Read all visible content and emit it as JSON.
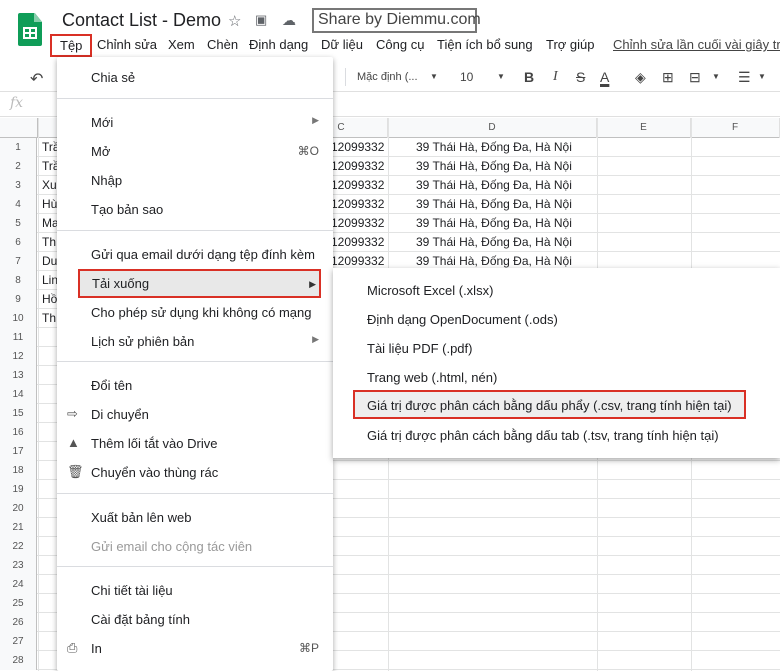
{
  "title_bar": {
    "doc_title": "Contact List - Demo",
    "watermark": "Share by Diemmu.com"
  },
  "menu_bar": {
    "items": [
      "Tệp",
      "Chỉnh sửa",
      "Xem",
      "Chèn",
      "Định dạng",
      "Dữ liệu",
      "Công cụ",
      "Tiện ích bổ sung",
      "Trợ giúp"
    ],
    "last_edit": "Chỉnh sửa lần cuối vài giây trước"
  },
  "toolbar": {
    "font": "Mặc định (...",
    "size": "10",
    "bold": "B",
    "italic": "I",
    "strike": "S",
    "text_color": "A"
  },
  "formula_bar": {
    "fx": "fx"
  },
  "columns": [
    "C",
    "D",
    "E",
    "F"
  ],
  "rows": [
    {
      "n": "1",
      "a": "Trầ",
      "c": "12099332",
      "d": "39 Thái Hà, Đống Đa, Hà Nội"
    },
    {
      "n": "2",
      "a": "Trầ",
      "c": "12099332",
      "d": "39 Thái Hà, Đống Đa, Hà Nội"
    },
    {
      "n": "3",
      "a": "Xu",
      "c": "12099332",
      "d": "39 Thái Hà, Đống Đa, Hà Nội"
    },
    {
      "n": "4",
      "a": "Hù",
      "c": "12099332",
      "d": "39 Thái Hà, Đống Đa, Hà Nội"
    },
    {
      "n": "5",
      "a": "Ma",
      "c": "12099332",
      "d": "39 Thái Hà, Đống Đa, Hà Nội"
    },
    {
      "n": "6",
      "a": "Th",
      "c": "12099332",
      "d": "39 Thái Hà, Đống Đa, Hà Nội"
    },
    {
      "n": "7",
      "a": "Du",
      "c": "12099332",
      "d": "39 Thái Hà, Đống Đa, Hà Nội"
    },
    {
      "n": "8",
      "a": "Lin",
      "c": "",
      "d": ""
    },
    {
      "n": "9",
      "a": "Hồ",
      "c": "",
      "d": ""
    },
    {
      "n": "10",
      "a": "Th",
      "c": "",
      "d": ""
    },
    {
      "n": "11",
      "a": "",
      "c": "",
      "d": ""
    },
    {
      "n": "12",
      "a": "",
      "c": "",
      "d": ""
    },
    {
      "n": "13",
      "a": "",
      "c": "",
      "d": ""
    },
    {
      "n": "14",
      "a": "",
      "c": "",
      "d": ""
    },
    {
      "n": "15",
      "a": "",
      "c": "",
      "d": ""
    },
    {
      "n": "16",
      "a": "",
      "c": "",
      "d": ""
    },
    {
      "n": "17",
      "a": "",
      "c": "",
      "d": ""
    },
    {
      "n": "18",
      "a": "",
      "c": "",
      "d": ""
    },
    {
      "n": "19",
      "a": "",
      "c": "",
      "d": ""
    },
    {
      "n": "20",
      "a": "",
      "c": "",
      "d": ""
    },
    {
      "n": "21",
      "a": "",
      "c": "",
      "d": ""
    },
    {
      "n": "22",
      "a": "",
      "c": "",
      "d": ""
    },
    {
      "n": "23",
      "a": "",
      "c": "",
      "d": ""
    },
    {
      "n": "24",
      "a": "",
      "c": "",
      "d": ""
    },
    {
      "n": "25",
      "a": "",
      "c": "",
      "d": ""
    },
    {
      "n": "26",
      "a": "",
      "c": "",
      "d": ""
    },
    {
      "n": "27",
      "a": "",
      "c": "",
      "d": ""
    },
    {
      "n": "28",
      "a": "",
      "c": "",
      "d": ""
    }
  ],
  "file_menu": {
    "share": "Chia sẻ",
    "new": "Mới",
    "open": "Mở",
    "open_sc": "⌘O",
    "import": "Nhập",
    "copy": "Tạo bản sao",
    "email_attach": "Gửi qua email dưới dạng tệp đính kèm",
    "download": "Tải xuống",
    "offline": "Cho phép sử dụng khi không có mạng",
    "version": "Lịch sử phiên bản",
    "rename": "Đổi tên",
    "move": "Di chuyển",
    "shortcut": "Thêm lối tắt vào Drive",
    "trash": "Chuyển vào thùng rác",
    "publish": "Xuất bản lên web",
    "email_collab": "Gửi email cho cộng tác viên",
    "details": "Chi tiết tài liệu",
    "settings": "Cài đặt bảng tính",
    "print": "In",
    "print_sc": "⌘P"
  },
  "download_menu": {
    "xlsx": "Microsoft Excel (.xlsx)",
    "ods": "Định dạng OpenDocument (.ods)",
    "pdf": "Tài liệu PDF (.pdf)",
    "html": "Trang web (.html, nén)",
    "csv": "Giá trị được phân cách bằng dấu phẩy (.csv, trang tính hiện tại)",
    "tsv": "Giá trị được phân cách bằng dấu tab (.tsv, trang tính hiện tại)"
  }
}
